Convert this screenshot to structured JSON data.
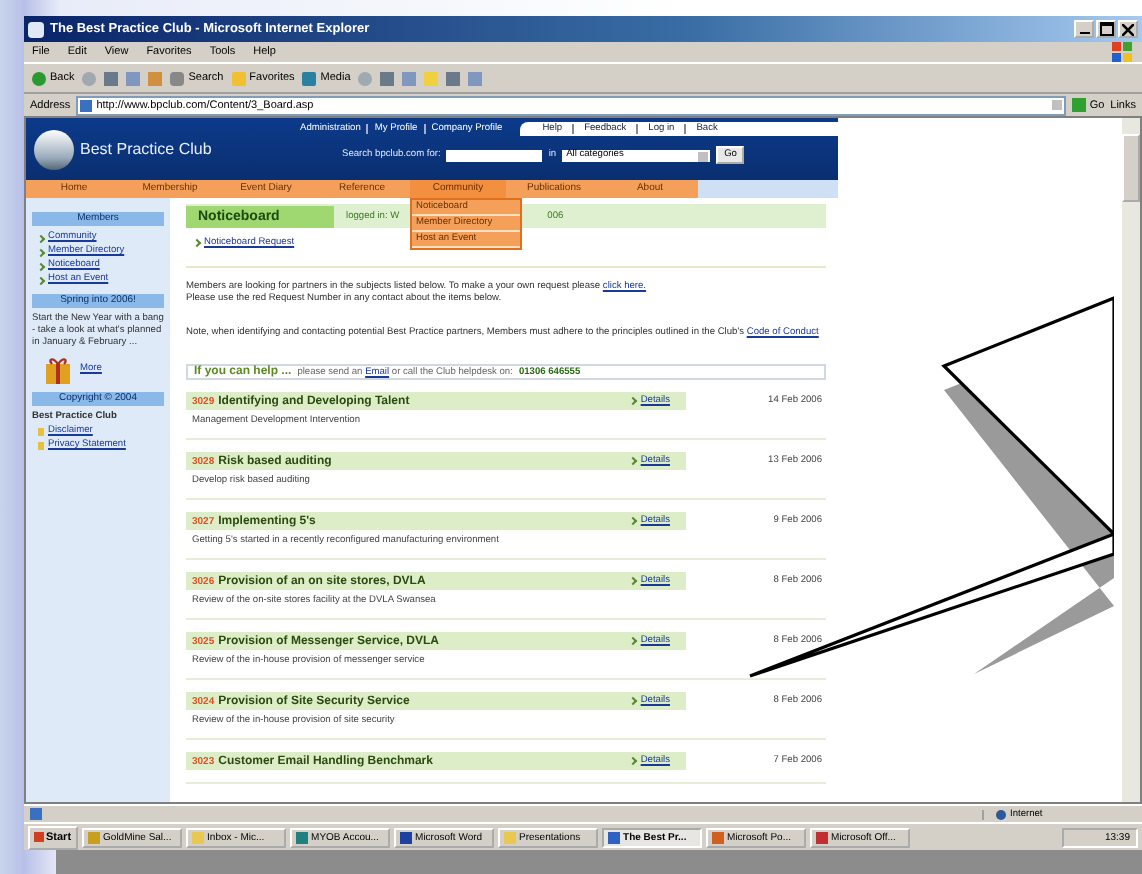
{
  "window": {
    "title": "The Best Practice Club - Microsoft Internet Explorer",
    "menu": [
      "File",
      "Edit",
      "View",
      "Favorites",
      "Tools",
      "Help"
    ],
    "toolbar": [
      "Back",
      "Search",
      "Favorites",
      "Media"
    ],
    "address_label": "Address",
    "address": "http://www.bpclub.com/Content/3_Board.asp",
    "go": "Go",
    "links": "Links"
  },
  "site": {
    "logo": "Best Practice Club",
    "top_links": [
      "Administration",
      "My Profile",
      "Company Profile"
    ],
    "utility_links": [
      "Help",
      "Feedback",
      "Log in",
      "Back"
    ],
    "search_label": "Search bpclub.com for:",
    "search_in": "in",
    "category": "All categories",
    "go": "Go",
    "nav": [
      {
        "label": "Home",
        "expanded": false
      },
      {
        "label": "Membership",
        "expanded": false
      },
      {
        "label": "Event Diary",
        "expanded": false
      },
      {
        "label": "Reference",
        "expanded": false
      },
      {
        "label": "Community",
        "expanded": true,
        "menu": [
          "Noticeboard",
          "Member Directory",
          "Host an Event"
        ]
      },
      {
        "label": "Publications",
        "expanded": false
      },
      {
        "label": "About",
        "expanded": false
      }
    ]
  },
  "sidebar": {
    "members_title": "Members",
    "members_links": [
      "Community",
      "Member Directory",
      "Noticeboard",
      "Host an Event"
    ],
    "promo_title": "Spring into 2006!",
    "promo_text": "Start the New Year with a bang - take a look at what's planned in January & February ...",
    "promo_link": "More",
    "copyright_title": "Copyright © 2004",
    "club": "Best Practice Club",
    "legal_links": [
      "Disclaimer",
      "Privacy Statement"
    ]
  },
  "main": {
    "title": "Noticeboard",
    "logged_in": "logged in: W",
    "logged_in_tail": "006",
    "request_link": "Noticeboard Request",
    "intro": "Members are looking for partners in the subjects listed below. To make a your own request please",
    "intro_link": "click here.",
    "intro2": "Please use the red Request Number in any contact about the items below.",
    "note": "Note, when identifying and contacting potential Best Practice partners, Members must adhere to the principles outlined in the Club's",
    "note_link": "Code of Conduct",
    "help_lead": "If you can help ...",
    "help_before": "please send an",
    "help_link": "Email",
    "help_after": "or call the Club helpdesk on:",
    "help_phone": "01306 646555",
    "items": [
      {
        "number": "3029",
        "title": "Identifying and Developing Talent",
        "details": "Details",
        "description": "Management Development Intervention",
        "date": "14 Feb 2006"
      },
      {
        "number": "3028",
        "title": "Risk based auditing",
        "details": "Details",
        "description": "Develop risk based auditing",
        "date": "13 Feb 2006"
      },
      {
        "number": "3027",
        "title": "Implementing 5's",
        "details": "Details",
        "description": "Getting 5's started in a recently reconfigured manufacturing environment",
        "date": "9 Feb 2006"
      },
      {
        "number": "3026",
        "title": "Provision of an on site stores, DVLA",
        "details": "Details",
        "description": "Review of the on-site stores facility at the DVLA Swansea",
        "date": "8 Feb 2006"
      },
      {
        "number": "3025",
        "title": "Provision of Messenger Service, DVLA",
        "details": "Details",
        "description": "Review of the in-house provision of messenger service",
        "date": "8 Feb 2006"
      },
      {
        "number": "3024",
        "title": "Provision of Site Security Service",
        "details": "Details",
        "description": "Review of the in-house provision of site security",
        "date": "8 Feb 2006"
      },
      {
        "number": "3023",
        "title": "Customer Email Handling Benchmark",
        "details": "Details",
        "date": "7 Feb 2006"
      }
    ]
  },
  "status_bar": {
    "zone": "Internet"
  },
  "taskbar": {
    "start": "Start",
    "tasks": [
      {
        "label": "GoldMine Sal...",
        "selected": false,
        "color": "#c8a020"
      },
      {
        "label": "Inbox - Mic...",
        "selected": false,
        "color": "#e8c850"
      },
      {
        "label": "MYOB Accou...",
        "selected": false,
        "color": "#208080"
      },
      {
        "label": "Microsoft Word",
        "selected": false,
        "color": "#2040a0"
      },
      {
        "label": "Presentations",
        "selected": false,
        "color": "#e8c850"
      },
      {
        "label": "The Best Pr...",
        "selected": true,
        "color": "#3060c0"
      },
      {
        "label": "Microsoft Po...",
        "selected": false,
        "color": "#d06020"
      },
      {
        "label": "Microsoft Off...",
        "selected": false,
        "color": "#c03030"
      }
    ],
    "clock": "13:39"
  }
}
